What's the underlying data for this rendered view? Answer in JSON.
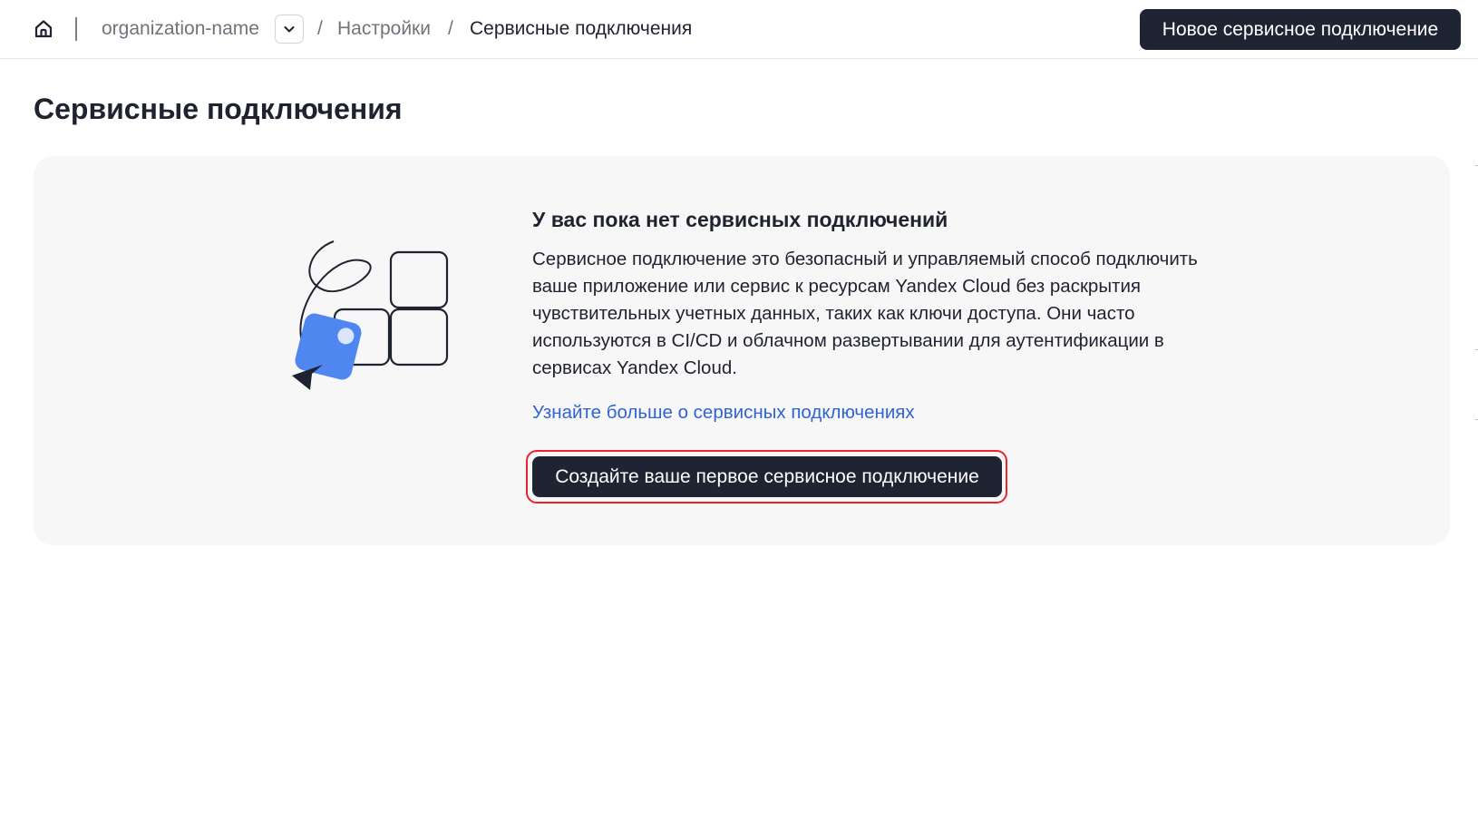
{
  "header": {
    "home_icon": "home-icon",
    "breadcrumb": {
      "organization": "organization-name",
      "dropdown_icon": "chevron-down-icon",
      "separator": "/",
      "settings": "Настройки",
      "current": "Сервисные подключения"
    },
    "new_connection_button": "Новое сервисное подключение"
  },
  "main": {
    "page_title": "Сервисные подключения",
    "empty_state": {
      "illustration_icon": "service-connection-illustration",
      "title": "У вас пока нет сервисных подключений",
      "description": "Сервисное подключение это безопасный и управляемый способ подключить ваше приложение или сервис к ресурсам Yandex Cloud без раскрытия чувствительных учетных данных, таких как ключи доступа. Они часто используются в CI/CD и облачном развертывании для аутентификации в сервисах Yandex Cloud.",
      "learn_more_link": "Узнайте больше о сервисных подключениях",
      "create_button": "Создайте ваше первое сервисное подключение"
    }
  },
  "colors": {
    "primary_button": "#1f2433",
    "link": "#2f63d6",
    "highlight": "#e8242e",
    "card_background": "#f7f7f7",
    "illustration_blue": "#4f86f0"
  }
}
